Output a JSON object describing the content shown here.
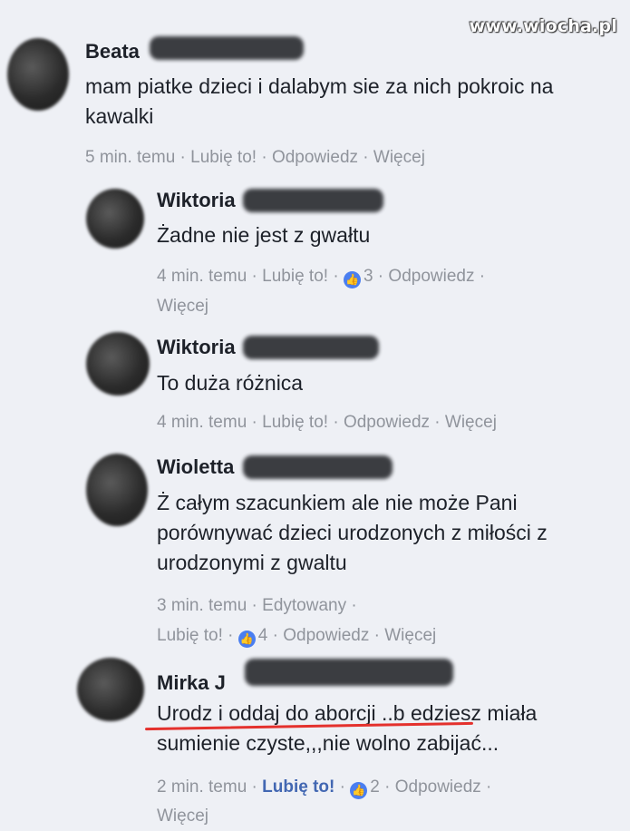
{
  "watermark": "www.wiocha.pl",
  "comments": [
    {
      "author": "Beata",
      "text": "mam piatke dzieci i dalabym sie za nich pokroic na kawalki",
      "time": "5 min. temu",
      "like": "Lubię to!",
      "reply": "Odpowiedz",
      "more": "Więcej"
    },
    {
      "author": "Wiktoria",
      "text": "Żadne nie jest z gwałtu",
      "time": "4 min. temu",
      "like": "Lubię to!",
      "reactions": "3",
      "reply": "Odpowiedz",
      "more": "Więcej"
    },
    {
      "author": "Wiktoria",
      "text": "To duża różnica",
      "time": "4 min. temu",
      "like": "Lubię to!",
      "reply": "Odpowiedz",
      "more": "Więcej"
    },
    {
      "author": "Wioletta",
      "text": "Ż całym szacunkiem ale nie może Pani porównywać dzieci urodzonych z miłości z urodzonymi z gwaltu",
      "time": "3 min. temu",
      "edited": "Edytowany",
      "like": "Lubię to!",
      "reactions": "4",
      "reply": "Odpowiedz",
      "more": "Więcej"
    },
    {
      "author": "Mirka",
      "author_initial": "J",
      "text": "Urodz i oddaj do aborcji ..b edziesz miała sumienie czyste,,,nie wolno zabijać...",
      "time": "2 min. temu",
      "like": "Lubię to!",
      "reactions": "2",
      "reply": "Odpowiedz",
      "more": "Więcej"
    }
  ],
  "colors": {
    "link": "#4267b2",
    "meta": "#90949c",
    "badge": "#4a7ef0",
    "underline": "#e4312d"
  },
  "icons": {
    "reaction": "thumbs-up-icon"
  }
}
